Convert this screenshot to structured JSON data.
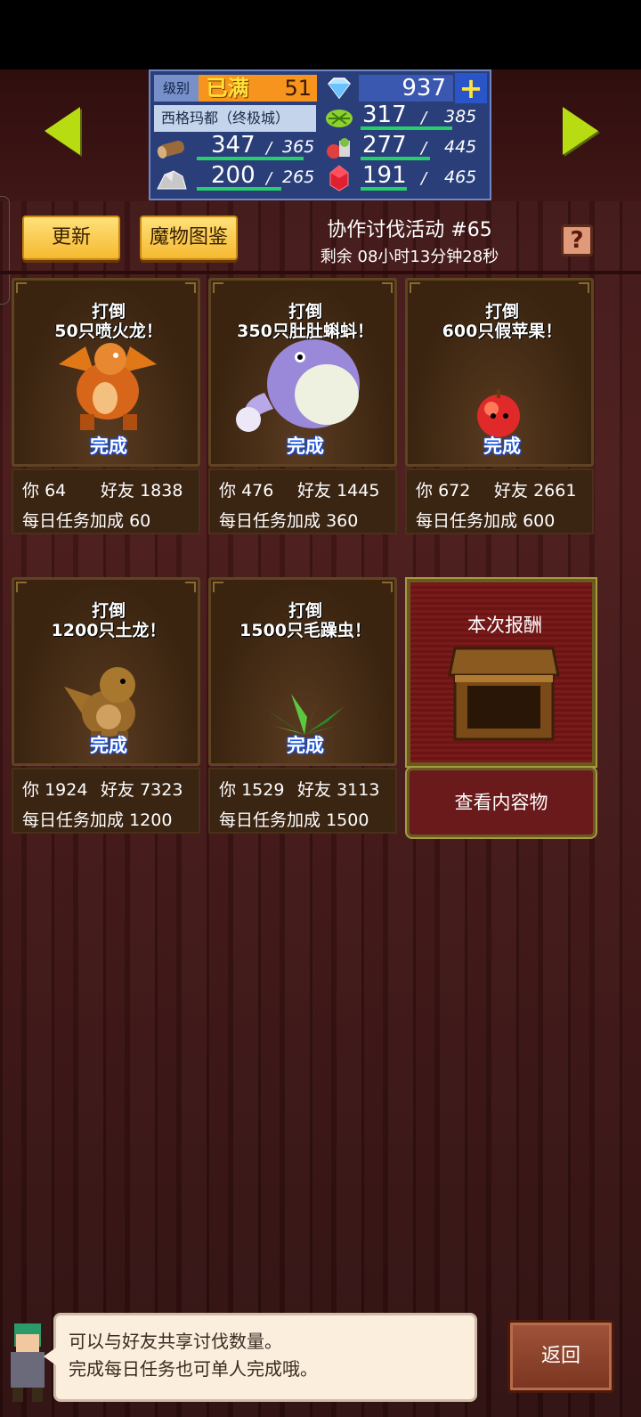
{
  "status": {
    "level_label": "级别",
    "level_max": "已满",
    "level": "51",
    "gems": "937",
    "plus": "+",
    "city": "西格玛都（终极城）",
    "resources": [
      {
        "name": "wood",
        "value": "347",
        "max": "365",
        "fill": 0.95
      },
      {
        "name": "grass",
        "value": "317",
        "max": "385",
        "fill": 0.82
      },
      {
        "name": "stone",
        "value": "200",
        "max": "265",
        "fill": 0.75
      },
      {
        "name": "food",
        "value": "277",
        "max": "445",
        "fill": 0.62
      },
      {
        "name": "ruby",
        "value": "191",
        "max": "465",
        "fill": 0.41
      }
    ]
  },
  "header": {
    "update_label": "更新",
    "monster_book_label": "魔物图鉴",
    "event_title": "协作讨伐活动 #65",
    "remaining": "剩余 08小时13分钟28秒",
    "help": "?"
  },
  "cards": [
    {
      "title1": "打倒",
      "title2": "50只喷火龙！",
      "done": "完成",
      "you_label": "你",
      "you": "64",
      "friend_label": "好友",
      "friend": "1838",
      "daily_label": "每日任务加成",
      "daily": "60"
    },
    {
      "title1": "打倒",
      "title2": "350只肚肚蝌蚪！",
      "done": "完成",
      "you_label": "你",
      "you": "476",
      "friend_label": "好友",
      "friend": "1445",
      "daily_label": "每日任务加成",
      "daily": "360"
    },
    {
      "title1": "打倒",
      "title2": "600只假苹果！",
      "done": "完成",
      "you_label": "你",
      "you": "672",
      "friend_label": "好友",
      "friend": "2661",
      "daily_label": "每日任务加成",
      "daily": "600"
    },
    {
      "title1": "打倒",
      "title2": "1200只土龙！",
      "done": "完成",
      "you_label": "你",
      "you": "1924",
      "friend_label": "好友",
      "friend": "7323",
      "daily_label": "每日任务加成",
      "daily": "1200"
    },
    {
      "title1": "打倒",
      "title2": "1500只毛躁虫！",
      "done": "完成",
      "you_label": "你",
      "you": "1529",
      "friend_label": "好友",
      "friend": "3113",
      "daily_label": "每日任务加成",
      "daily": "1500"
    }
  ],
  "reward": {
    "title": "本次报酬",
    "view_label": "查看内容物"
  },
  "hint": {
    "line1": "可以与好友共享讨伐数量。",
    "line2": "完成每日任务也可单人完成哦。"
  },
  "back_label": "返回",
  "colors": {
    "accent": "#b8dc12",
    "button_yellow": "#f5b930",
    "done_blue": "#1040c0"
  }
}
